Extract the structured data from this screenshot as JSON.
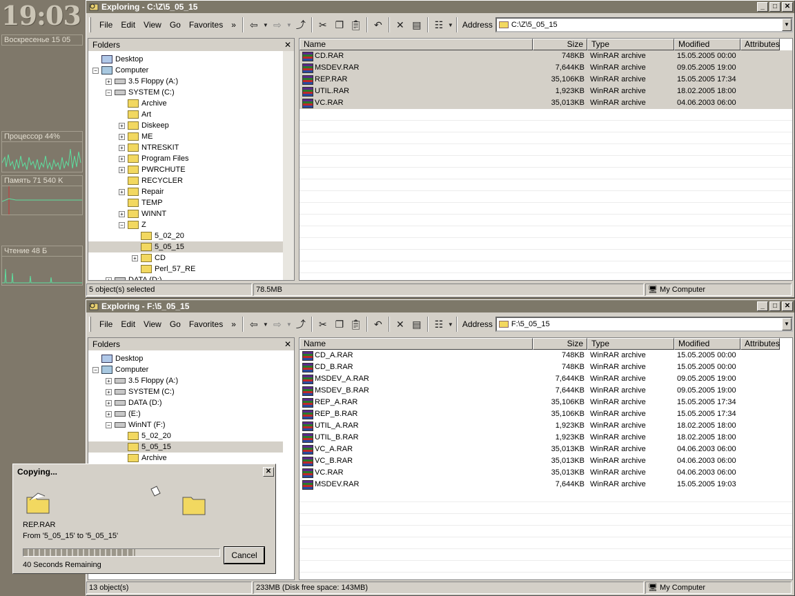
{
  "desktop": {
    "clock": "19:03",
    "date": "Воскресенье 15 05",
    "cpu_label": "Процессор 44%",
    "mem_label": "Память 71 540 K",
    "read_label": "Чтение 48 Б"
  },
  "win1": {
    "title": "Exploring - C:\\Z\\5_05_15",
    "menu": [
      "File",
      "Edit",
      "View",
      "Go",
      "Favorites"
    ],
    "address_label": "Address",
    "address": "C:\\Z\\5_05_15",
    "folders_title": "Folders",
    "tree": [
      {
        "label": "Desktop",
        "pm": ""
      },
      {
        "label": "Computer",
        "pm": "−"
      },
      {
        "label": "3.5 Floppy (A:)",
        "pm": "+"
      },
      {
        "label": "SYSTEM (C:)",
        "pm": "−"
      },
      {
        "label": "Archive",
        "pm": ""
      },
      {
        "label": "Art",
        "pm": ""
      },
      {
        "label": "Diskeep",
        "pm": "+"
      },
      {
        "label": "ME",
        "pm": "+"
      },
      {
        "label": "NTRESKIT",
        "pm": "+"
      },
      {
        "label": "Program Files",
        "pm": "+"
      },
      {
        "label": "PWRCHUTE",
        "pm": "+"
      },
      {
        "label": "RECYCLER",
        "pm": ""
      },
      {
        "label": "Repair",
        "pm": "+"
      },
      {
        "label": "TEMP",
        "pm": ""
      },
      {
        "label": "WINNT",
        "pm": "+"
      },
      {
        "label": "Z",
        "pm": "−"
      },
      {
        "label": "5_02_20",
        "pm": ""
      },
      {
        "label": "5_05_15",
        "pm": ""
      },
      {
        "label": "CD",
        "pm": "+"
      },
      {
        "label": "Perl_57_RE",
        "pm": ""
      },
      {
        "label": "DATA (D:)",
        "pm": "+"
      }
    ],
    "columns": [
      "Name",
      "Size",
      "Type",
      "Modified",
      "Attributes"
    ],
    "files": [
      {
        "name": "CD.RAR",
        "size": "748KB",
        "type": "WinRAR archive",
        "modified": "15.05.2005 00:00"
      },
      {
        "name": "MSDEV.RAR",
        "size": "7,644KB",
        "type": "WinRAR archive",
        "modified": "09.05.2005 19:00"
      },
      {
        "name": "REP.RAR",
        "size": "35,106KB",
        "type": "WinRAR archive",
        "modified": "15.05.2005 17:34"
      },
      {
        "name": "UTIL.RAR",
        "size": "1,923KB",
        "type": "WinRAR archive",
        "modified": "18.02.2005 18:00"
      },
      {
        "name": "VC.RAR",
        "size": "35,013KB",
        "type": "WinRAR archive",
        "modified": "04.06.2003 06:00"
      }
    ],
    "status_left": "5 object(s) selected",
    "status_mid": "78.5MB",
    "status_right": "My Computer"
  },
  "win2": {
    "title": "Exploring - F:\\5_05_15",
    "menu": [
      "File",
      "Edit",
      "View",
      "Go",
      "Favorites"
    ],
    "address_label": "Address",
    "address": "F:\\5_05_15",
    "folders_title": "Folders",
    "tree": [
      {
        "label": "Desktop",
        "pm": ""
      },
      {
        "label": "Computer",
        "pm": "−"
      },
      {
        "label": "3.5 Floppy (A:)",
        "pm": "+"
      },
      {
        "label": "SYSTEM (C:)",
        "pm": "+"
      },
      {
        "label": "DATA (D:)",
        "pm": "+"
      },
      {
        "label": "(E:)",
        "pm": "+"
      },
      {
        "label": "WinNT (F:)",
        "pm": "−"
      },
      {
        "label": "5_02_20",
        "pm": ""
      },
      {
        "label": "5_05_15",
        "pm": ""
      },
      {
        "label": "Archive",
        "pm": ""
      }
    ],
    "columns": [
      "Name",
      "Size",
      "Type",
      "Modified",
      "Attributes"
    ],
    "files": [
      {
        "name": "CD_A.RAR",
        "size": "748KB",
        "type": "WinRAR archive",
        "modified": "15.05.2005 00:00"
      },
      {
        "name": "CD_B.RAR",
        "size": "748KB",
        "type": "WinRAR archive",
        "modified": "15.05.2005 00:00"
      },
      {
        "name": "MSDEV_A.RAR",
        "size": "7,644KB",
        "type": "WinRAR archive",
        "modified": "09.05.2005 19:00"
      },
      {
        "name": "MSDEV_B.RAR",
        "size": "7,644KB",
        "type": "WinRAR archive",
        "modified": "09.05.2005 19:00"
      },
      {
        "name": "REP_A.RAR",
        "size": "35,106KB",
        "type": "WinRAR archive",
        "modified": "15.05.2005 17:34"
      },
      {
        "name": "REP_B.RAR",
        "size": "35,106KB",
        "type": "WinRAR archive",
        "modified": "15.05.2005 17:34"
      },
      {
        "name": "UTIL_A.RAR",
        "size": "1,923KB",
        "type": "WinRAR archive",
        "modified": "18.02.2005 18:00"
      },
      {
        "name": "UTIL_B.RAR",
        "size": "1,923KB",
        "type": "WinRAR archive",
        "modified": "18.02.2005 18:00"
      },
      {
        "name": "VC_A.RAR",
        "size": "35,013KB",
        "type": "WinRAR archive",
        "modified": "04.06.2003 06:00"
      },
      {
        "name": "VC_B.RAR",
        "size": "35,013KB",
        "type": "WinRAR archive",
        "modified": "04.06.2003 06:00"
      },
      {
        "name": "VC.RAR",
        "size": "35,013KB",
        "type": "WinRAR archive",
        "modified": "04.06.2003 06:00"
      },
      {
        "name": "MSDEV.RAR",
        "size": "7,644KB",
        "type": "WinRAR archive",
        "modified": "15.05.2005 19:03"
      }
    ],
    "status_left": "13 object(s)",
    "status_mid": "233MB (Disk free space: 143MB)",
    "status_right": "My Computer"
  },
  "copy_dialog": {
    "title": "Copying...",
    "file": "REP.RAR",
    "from_to": "From '5_05_15' to '5_05_15'",
    "remaining": "40 Seconds Remaining",
    "cancel": "Cancel",
    "progress_fraction": 0.57
  }
}
